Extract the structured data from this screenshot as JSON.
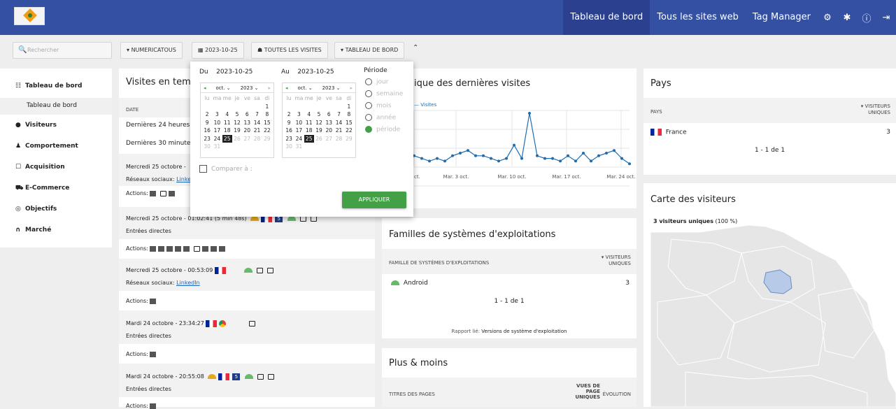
{
  "topnav": {
    "links": [
      "Tableau de bord",
      "Tous les sites web",
      "Tag Manager"
    ]
  },
  "search": {
    "placeholder": "Rechercher"
  },
  "selectors": {
    "site": "NUMERICATOUS",
    "date": "2023-10-25",
    "segment": "TOUTES LES VISITES",
    "dashboard": "TABLEAU DE BORD"
  },
  "sidebar": {
    "items": [
      "Tableau de bord",
      "Visiteurs",
      "Comportement",
      "Acquisition",
      "E-Commerce",
      "Objectifs",
      "Marché"
    ],
    "sub": "Tableau de bord"
  },
  "realtime": {
    "title": "Visites en temps réel",
    "date_col": "DATE",
    "rows": [
      "Dernières 24 heures",
      "Dernières 30 minutes"
    ],
    "visits": [
      {
        "time": "Mercredi 25 octobre -",
        "ref": "Réseaux sociaux: ",
        "link": "LinkedIn",
        "actions": "Actions:"
      },
      {
        "time": "Mercredi 25 octobre - 01:02:41 (5 min 48s)",
        "ref": "Entrées directes",
        "actions": "Actions:"
      },
      {
        "time": "Mercredi 25 octobre - 00:53:09",
        "ref": "Réseaux sociaux: ",
        "link": "LinkedIn",
        "actions": "Actions:"
      },
      {
        "time": "Mardi 24 octobre - 23:34:27",
        "ref": "Entrées directes",
        "actions": "Actions:"
      },
      {
        "time": "Mardi 24 octobre - 20:55:08",
        "ref": "Entrées directes",
        "actions": "Actions:"
      }
    ]
  },
  "history": {
    "title": "ique des dernières visites",
    "legend": "Visites",
    "ticks": [
      "ct.",
      "Mar. 3 oct.",
      "Mar. 10 oct.",
      "Mar. 17 oct.",
      "Mar. 24 oct."
    ]
  },
  "chart_data": {
    "type": "line",
    "series": [
      {
        "name": "Visites",
        "values": [
          4,
          3,
          2,
          3,
          2,
          4,
          5,
          6,
          4,
          4,
          3,
          2,
          3,
          8,
          3,
          20,
          4,
          3,
          3,
          2,
          4,
          2,
          5,
          2,
          4,
          5,
          6,
          3,
          1
        ]
      }
    ]
  },
  "os": {
    "title": "Familles de systèmes d'exploitations",
    "col1": "FAMILLE DE SYSTÈMES D'EXPLOITATIONS",
    "col2a": "VISITEURS",
    "col2b": "UNIQUES",
    "row": "Android",
    "value": "3",
    "pager": "1 - 1 de 1",
    "related_label": "Rapport lié: ",
    "related": "Versions de système d'exploitation"
  },
  "plusmoins": {
    "title": "Plus & moins",
    "col1": "TITRES DES PAGES",
    "col2a": "VUES DE",
    "col2b": "PAGE",
    "col2c": "UNIQUES",
    "col3": "ÉVOLUTION"
  },
  "pays": {
    "title": "Pays",
    "col1": "PAYS",
    "col2a": "VISITEURS",
    "col2b": "UNIQUES",
    "row": "France",
    "value": "3",
    "pager": "1 - 1 de 1"
  },
  "carte": {
    "title": "Carte des visiteurs",
    "summary_b": "3 visiteurs uniques",
    "summary": " (100 %)"
  },
  "popup": {
    "du": "Du",
    "du_date": "2023-10-25",
    "au": "Au",
    "au_date": "2023-10-25",
    "month": "oct.",
    "year": "2023",
    "periode": "Période",
    "periods": [
      "jour",
      "semaine",
      "mois",
      "année",
      "période"
    ],
    "compare": "Comparer à :",
    "apply": "APPLIQUER"
  }
}
